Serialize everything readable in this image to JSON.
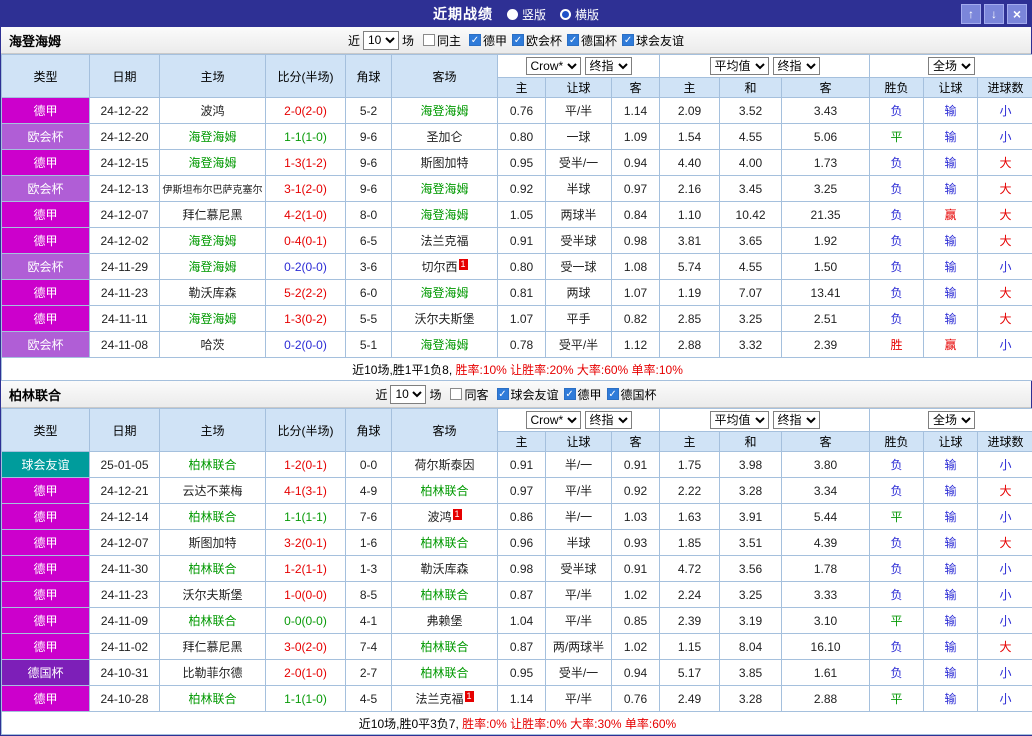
{
  "titlebar": {
    "title": "近期战绩",
    "radios": {
      "vertical": "竖版",
      "horizontal": "横版",
      "selected": "横版"
    },
    "up_icon": "↑",
    "down_icon": "↓",
    "close_icon": "×"
  },
  "headers": {
    "type": "类型",
    "date": "日期",
    "home": "主场",
    "score": "比分(半场)",
    "corner": "角球",
    "away": "客场",
    "dd_bookmaker": "Crow*",
    "dd_final": "终指",
    "dd_average": "平均值",
    "dd_fullmatch": "全场",
    "sub": [
      "主",
      "让球",
      "客",
      "主",
      "和",
      "客",
      "胜负",
      "让球",
      "进球数"
    ]
  },
  "icons": {
    "check": "✓"
  },
  "colors": {
    "titlebar_bg": "#2e3094",
    "subject_team": "#009900",
    "badge": "#e60000",
    "league": {
      "德甲": "#cc00cc",
      "欧会杯": "#b05ed6",
      "德国杯": "#7d1fb8",
      "球会友谊": "#009c9c"
    },
    "score_palette": {
      "red": "#e60000",
      "green": "#089a08",
      "blue": "#2b2bd5"
    },
    "outcome": {
      "胜": "#e60000",
      "平": "#089a08",
      "负": "#2b2bd5",
      "赢": "#e60000",
      "走": "#089a08",
      "输": "#2b2bd5",
      "大": "#e60000",
      "小": "#2b2bd5"
    }
  },
  "sections": [
    {
      "team": "海登海姆",
      "filter": {
        "near": "近",
        "count": "10",
        "games": "场",
        "same_label": "同主",
        "same_checked": false,
        "leagues": [
          "德甲",
          "欧会杯",
          "德国杯",
          "球会友谊"
        ]
      },
      "rows": [
        {
          "league": "德甲",
          "date": "24-12-22",
          "home": "波鸿",
          "home_subject": false,
          "score": "2-0(2-0)",
          "score_color": "red",
          "corners": "5-2",
          "away": "海登海姆",
          "away_subject": true,
          "odds": [
            "0.76",
            "平/半",
            "1.14",
            "2.09",
            "3.52",
            "3.43"
          ],
          "outcome": [
            "负",
            "输",
            "小"
          ]
        },
        {
          "league": "欧会杯",
          "date": "24-12-20",
          "home": "海登海姆",
          "home_subject": true,
          "score": "1-1(1-0)",
          "score_color": "green",
          "corners": "9-6",
          "away": "圣加仑",
          "away_subject": false,
          "odds": [
            "0.80",
            "一球",
            "1.09",
            "1.54",
            "4.55",
            "5.06"
          ],
          "outcome": [
            "平",
            "输",
            "小"
          ]
        },
        {
          "league": "德甲",
          "date": "24-12-15",
          "home": "海登海姆",
          "home_subject": true,
          "score": "1-3(1-2)",
          "score_color": "red",
          "corners": "9-6",
          "away": "斯图加特",
          "away_subject": false,
          "odds": [
            "0.95",
            "受半/一",
            "0.94",
            "4.40",
            "4.00",
            "1.73"
          ],
          "outcome": [
            "负",
            "输",
            "大"
          ]
        },
        {
          "league": "欧会杯",
          "date": "24-12-13",
          "home": "伊斯坦布尔巴萨克塞尔",
          "home_subject": false,
          "score": "3-1(2-0)",
          "score_color": "red",
          "corners": "9-6",
          "away": "海登海姆",
          "away_subject": true,
          "odds": [
            "0.92",
            "半球",
            "0.97",
            "2.16",
            "3.45",
            "3.25"
          ],
          "outcome": [
            "负",
            "输",
            "大"
          ]
        },
        {
          "league": "德甲",
          "date": "24-12-07",
          "home": "拜仁慕尼黑",
          "home_subject": false,
          "score": "4-2(1-0)",
          "score_color": "red",
          "corners": "8-0",
          "away": "海登海姆",
          "away_subject": true,
          "odds": [
            "1.05",
            "两球半",
            "0.84",
            "1.10",
            "10.42",
            "21.35"
          ],
          "outcome": [
            "负",
            "赢",
            "大"
          ]
        },
        {
          "league": "德甲",
          "date": "24-12-02",
          "home": "海登海姆",
          "home_subject": true,
          "score": "0-4(0-1)",
          "score_color": "red",
          "corners": "6-5",
          "away": "法兰克福",
          "away_subject": false,
          "odds": [
            "0.91",
            "受半球",
            "0.98",
            "3.81",
            "3.65",
            "1.92"
          ],
          "outcome": [
            "负",
            "输",
            "大"
          ]
        },
        {
          "league": "欧会杯",
          "date": "24-11-29",
          "home": "海登海姆",
          "home_subject": true,
          "score": "0-2(0-0)",
          "score_color": "blue",
          "corners": "3-6",
          "away": "切尔西",
          "away_subject": false,
          "away_badge": "1",
          "odds": [
            "0.80",
            "受一球",
            "1.08",
            "5.74",
            "4.55",
            "1.50"
          ],
          "outcome": [
            "负",
            "输",
            "小"
          ]
        },
        {
          "league": "德甲",
          "date": "24-11-23",
          "home": "勒沃库森",
          "home_subject": false,
          "score": "5-2(2-2)",
          "score_color": "red",
          "corners": "6-0",
          "away": "海登海姆",
          "away_subject": true,
          "odds": [
            "0.81",
            "两球",
            "1.07",
            "1.19",
            "7.07",
            "13.41"
          ],
          "outcome": [
            "负",
            "输",
            "大"
          ]
        },
        {
          "league": "德甲",
          "date": "24-11-11",
          "home": "海登海姆",
          "home_subject": true,
          "score": "1-3(0-2)",
          "score_color": "red",
          "corners": "5-5",
          "away": "沃尔夫斯堡",
          "away_subject": false,
          "odds": [
            "1.07",
            "平手",
            "0.82",
            "2.85",
            "3.25",
            "2.51"
          ],
          "outcome": [
            "负",
            "输",
            "大"
          ]
        },
        {
          "league": "欧会杯",
          "date": "24-11-08",
          "home": "哈茨",
          "home_subject": false,
          "score": "0-2(0-0)",
          "score_color": "blue",
          "corners": "5-1",
          "away": "海登海姆",
          "away_subject": true,
          "odds": [
            "0.78",
            "受平/半",
            "1.12",
            "2.88",
            "3.32",
            "2.39"
          ],
          "outcome": [
            "胜",
            "赢",
            "小"
          ]
        }
      ],
      "summary": {
        "prefix": "近10场,胜1平1负8,",
        "stats": " 胜率:10%  让胜率:20%  大率:60%  单率:10%"
      }
    },
    {
      "team": "柏林联合",
      "filter": {
        "near": "近",
        "count": "10",
        "games": "场",
        "same_label": "同客",
        "same_checked": false,
        "leagues": [
          "球会友谊",
          "德甲",
          "德国杯"
        ]
      },
      "rows": [
        {
          "league": "球会友谊",
          "date": "25-01-05",
          "home": "柏林联合",
          "home_subject": true,
          "score": "1-2(0-1)",
          "score_color": "red",
          "corners": "0-0",
          "away": "荷尔斯泰因",
          "away_subject": false,
          "odds": [
            "0.91",
            "半/一",
            "0.91",
            "1.75",
            "3.98",
            "3.80"
          ],
          "outcome": [
            "负",
            "输",
            "小"
          ]
        },
        {
          "league": "德甲",
          "date": "24-12-21",
          "home": "云达不莱梅",
          "home_subject": false,
          "score": "4-1(3-1)",
          "score_color": "red",
          "corners": "4-9",
          "away": "柏林联合",
          "away_subject": true,
          "odds": [
            "0.97",
            "平/半",
            "0.92",
            "2.22",
            "3.28",
            "3.34"
          ],
          "outcome": [
            "负",
            "输",
            "大"
          ]
        },
        {
          "league": "德甲",
          "date": "24-12-14",
          "home": "柏林联合",
          "home_subject": true,
          "score": "1-1(1-1)",
          "score_color": "green",
          "corners": "7-6",
          "away": "波鸿",
          "away_subject": false,
          "away_badge": "1",
          "odds": [
            "0.86",
            "半/一",
            "1.03",
            "1.63",
            "3.91",
            "5.44"
          ],
          "outcome": [
            "平",
            "输",
            "小"
          ]
        },
        {
          "league": "德甲",
          "date": "24-12-07",
          "home": "斯图加特",
          "home_subject": false,
          "score": "3-2(0-1)",
          "score_color": "red",
          "corners": "1-6",
          "away": "柏林联合",
          "away_subject": true,
          "odds": [
            "0.96",
            "半球",
            "0.93",
            "1.85",
            "3.51",
            "4.39"
          ],
          "outcome": [
            "负",
            "输",
            "大"
          ]
        },
        {
          "league": "德甲",
          "date": "24-11-30",
          "home": "柏林联合",
          "home_subject": true,
          "score": "1-2(1-1)",
          "score_color": "red",
          "corners": "1-3",
          "away": "勒沃库森",
          "away_subject": false,
          "odds": [
            "0.98",
            "受半球",
            "0.91",
            "4.72",
            "3.56",
            "1.78"
          ],
          "outcome": [
            "负",
            "输",
            "小"
          ]
        },
        {
          "league": "德甲",
          "date": "24-11-23",
          "home": "沃尔夫斯堡",
          "home_subject": false,
          "score": "1-0(0-0)",
          "score_color": "red",
          "corners": "8-5",
          "away": "柏林联合",
          "away_subject": true,
          "odds": [
            "0.87",
            "平/半",
            "1.02",
            "2.24",
            "3.25",
            "3.33"
          ],
          "outcome": [
            "负",
            "输",
            "小"
          ]
        },
        {
          "league": "德甲",
          "date": "24-11-09",
          "home": "柏林联合",
          "home_subject": true,
          "score": "0-0(0-0)",
          "score_color": "green",
          "corners": "4-1",
          "away": "弗赖堡",
          "away_subject": false,
          "odds": [
            "1.04",
            "平/半",
            "0.85",
            "2.39",
            "3.19",
            "3.10"
          ],
          "outcome": [
            "平",
            "输",
            "小"
          ]
        },
        {
          "league": "德甲",
          "date": "24-11-02",
          "home": "拜仁慕尼黑",
          "home_subject": false,
          "score": "3-0(2-0)",
          "score_color": "red",
          "corners": "7-4",
          "away": "柏林联合",
          "away_subject": true,
          "odds": [
            "0.87",
            "两/两球半",
            "1.02",
            "1.15",
            "8.04",
            "16.10"
          ],
          "outcome": [
            "负",
            "输",
            "大"
          ]
        },
        {
          "league": "德国杯",
          "date": "24-10-31",
          "home": "比勒菲尔德",
          "home_subject": false,
          "score": "2-0(1-0)",
          "score_color": "red",
          "corners": "2-7",
          "away": "柏林联合",
          "away_subject": true,
          "odds": [
            "0.95",
            "受半/一",
            "0.94",
            "5.17",
            "3.85",
            "1.61"
          ],
          "outcome": [
            "负",
            "输",
            "小"
          ]
        },
        {
          "league": "德甲",
          "date": "24-10-28",
          "home": "柏林联合",
          "home_subject": true,
          "score": "1-1(1-0)",
          "score_color": "green",
          "corners": "4-5",
          "away": "法兰克福",
          "away_subject": false,
          "away_badge": "1",
          "odds": [
            "1.14",
            "平/半",
            "0.76",
            "2.49",
            "3.28",
            "2.88"
          ],
          "outcome": [
            "平",
            "输",
            "小"
          ]
        }
      ],
      "summary": {
        "prefix": "近10场,胜0平3负7,",
        "stats": " 胜率:0%  让胜率:0%  大率:30%  单率:60%"
      }
    }
  ]
}
